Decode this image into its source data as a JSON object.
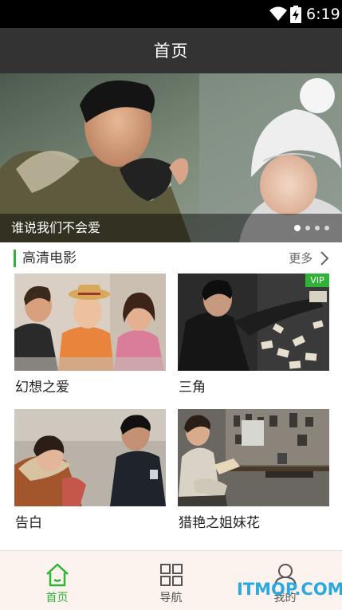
{
  "status_bar": {
    "time": "6:19",
    "icons": [
      "wifi-icon",
      "battery-charging-icon"
    ]
  },
  "header": {
    "title": "首页"
  },
  "banner": {
    "caption": "谁说我们不会爱",
    "slide_count": 4,
    "active_slide": 1
  },
  "section": {
    "title": "高清电影",
    "more_label": "更多",
    "accent_color": "#2fb236"
  },
  "movies": [
    {
      "title": "幻想之爱",
      "vip": false
    },
    {
      "title": "三角",
      "vip": true,
      "badge": "VIP"
    },
    {
      "title": "告白",
      "vip": false
    },
    {
      "title": "猎艳之姐妹花",
      "vip": false
    }
  ],
  "bottom_nav": {
    "active_color": "#2fb236",
    "items": [
      {
        "label": "首页",
        "icon": "home-icon",
        "active": true
      },
      {
        "label": "导航",
        "icon": "grid-icon",
        "active": false
      },
      {
        "label": "我的",
        "icon": "user-icon",
        "active": false
      }
    ]
  },
  "watermark": "ITMOP.COM"
}
